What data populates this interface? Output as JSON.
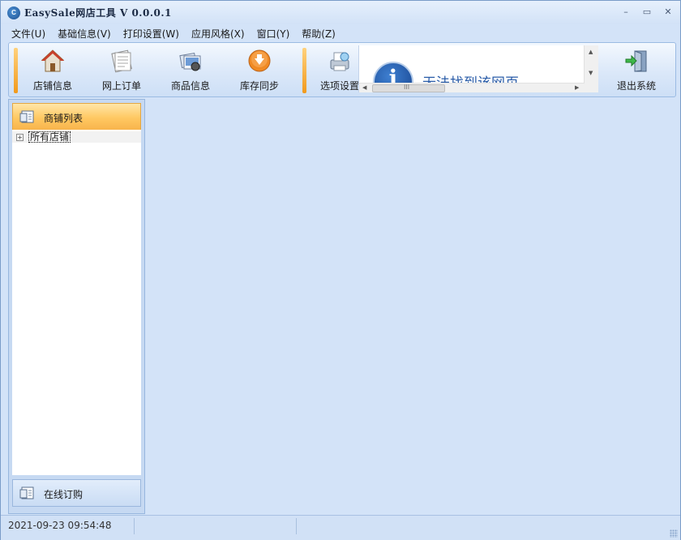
{
  "window": {
    "title": "EasySale网店工具 V 0.0.0.1",
    "icon": "easysale-logo-icon",
    "app_icon_glyph": "C"
  },
  "window_controls": {
    "minimize": "–",
    "maximize": "▭",
    "close": "✕"
  },
  "menu": [
    {
      "label": "文件(U)"
    },
    {
      "label": "基础信息(V)"
    },
    {
      "label": "打印设置(W)"
    },
    {
      "label": "应用风格(X)"
    },
    {
      "label": "窗口(Y)"
    },
    {
      "label": "帮助(Z)"
    }
  ],
  "toolbar": {
    "items": [
      {
        "label": "店铺信息",
        "icon": "shop-house-icon"
      },
      {
        "label": "网上订单",
        "icon": "order-document-icon"
      },
      {
        "label": "商品信息",
        "icon": "product-gallery-icon"
      },
      {
        "label": "库存同步",
        "icon": "sync-download-icon"
      },
      {
        "label": "选项设置",
        "icon": "settings-printer-icon"
      },
      {
        "label": "退出系统",
        "icon": "exit-door-icon"
      }
    ],
    "browser_message": "无法找到该网页",
    "hscroll_thumb_text": "III"
  },
  "left_panel": {
    "header_title": "商铺列表",
    "tree": [
      {
        "label": "所有店铺",
        "expander": "+"
      }
    ],
    "footer_title": "在线订购"
  },
  "status": {
    "datetime": "2021-09-23 09:54:48"
  },
  "colors": {
    "accent_orange": "#f19a1c",
    "header_gold": "#ffc862",
    "background_blue": "#d3e3f8",
    "link_blue": "#2a5ca8"
  }
}
